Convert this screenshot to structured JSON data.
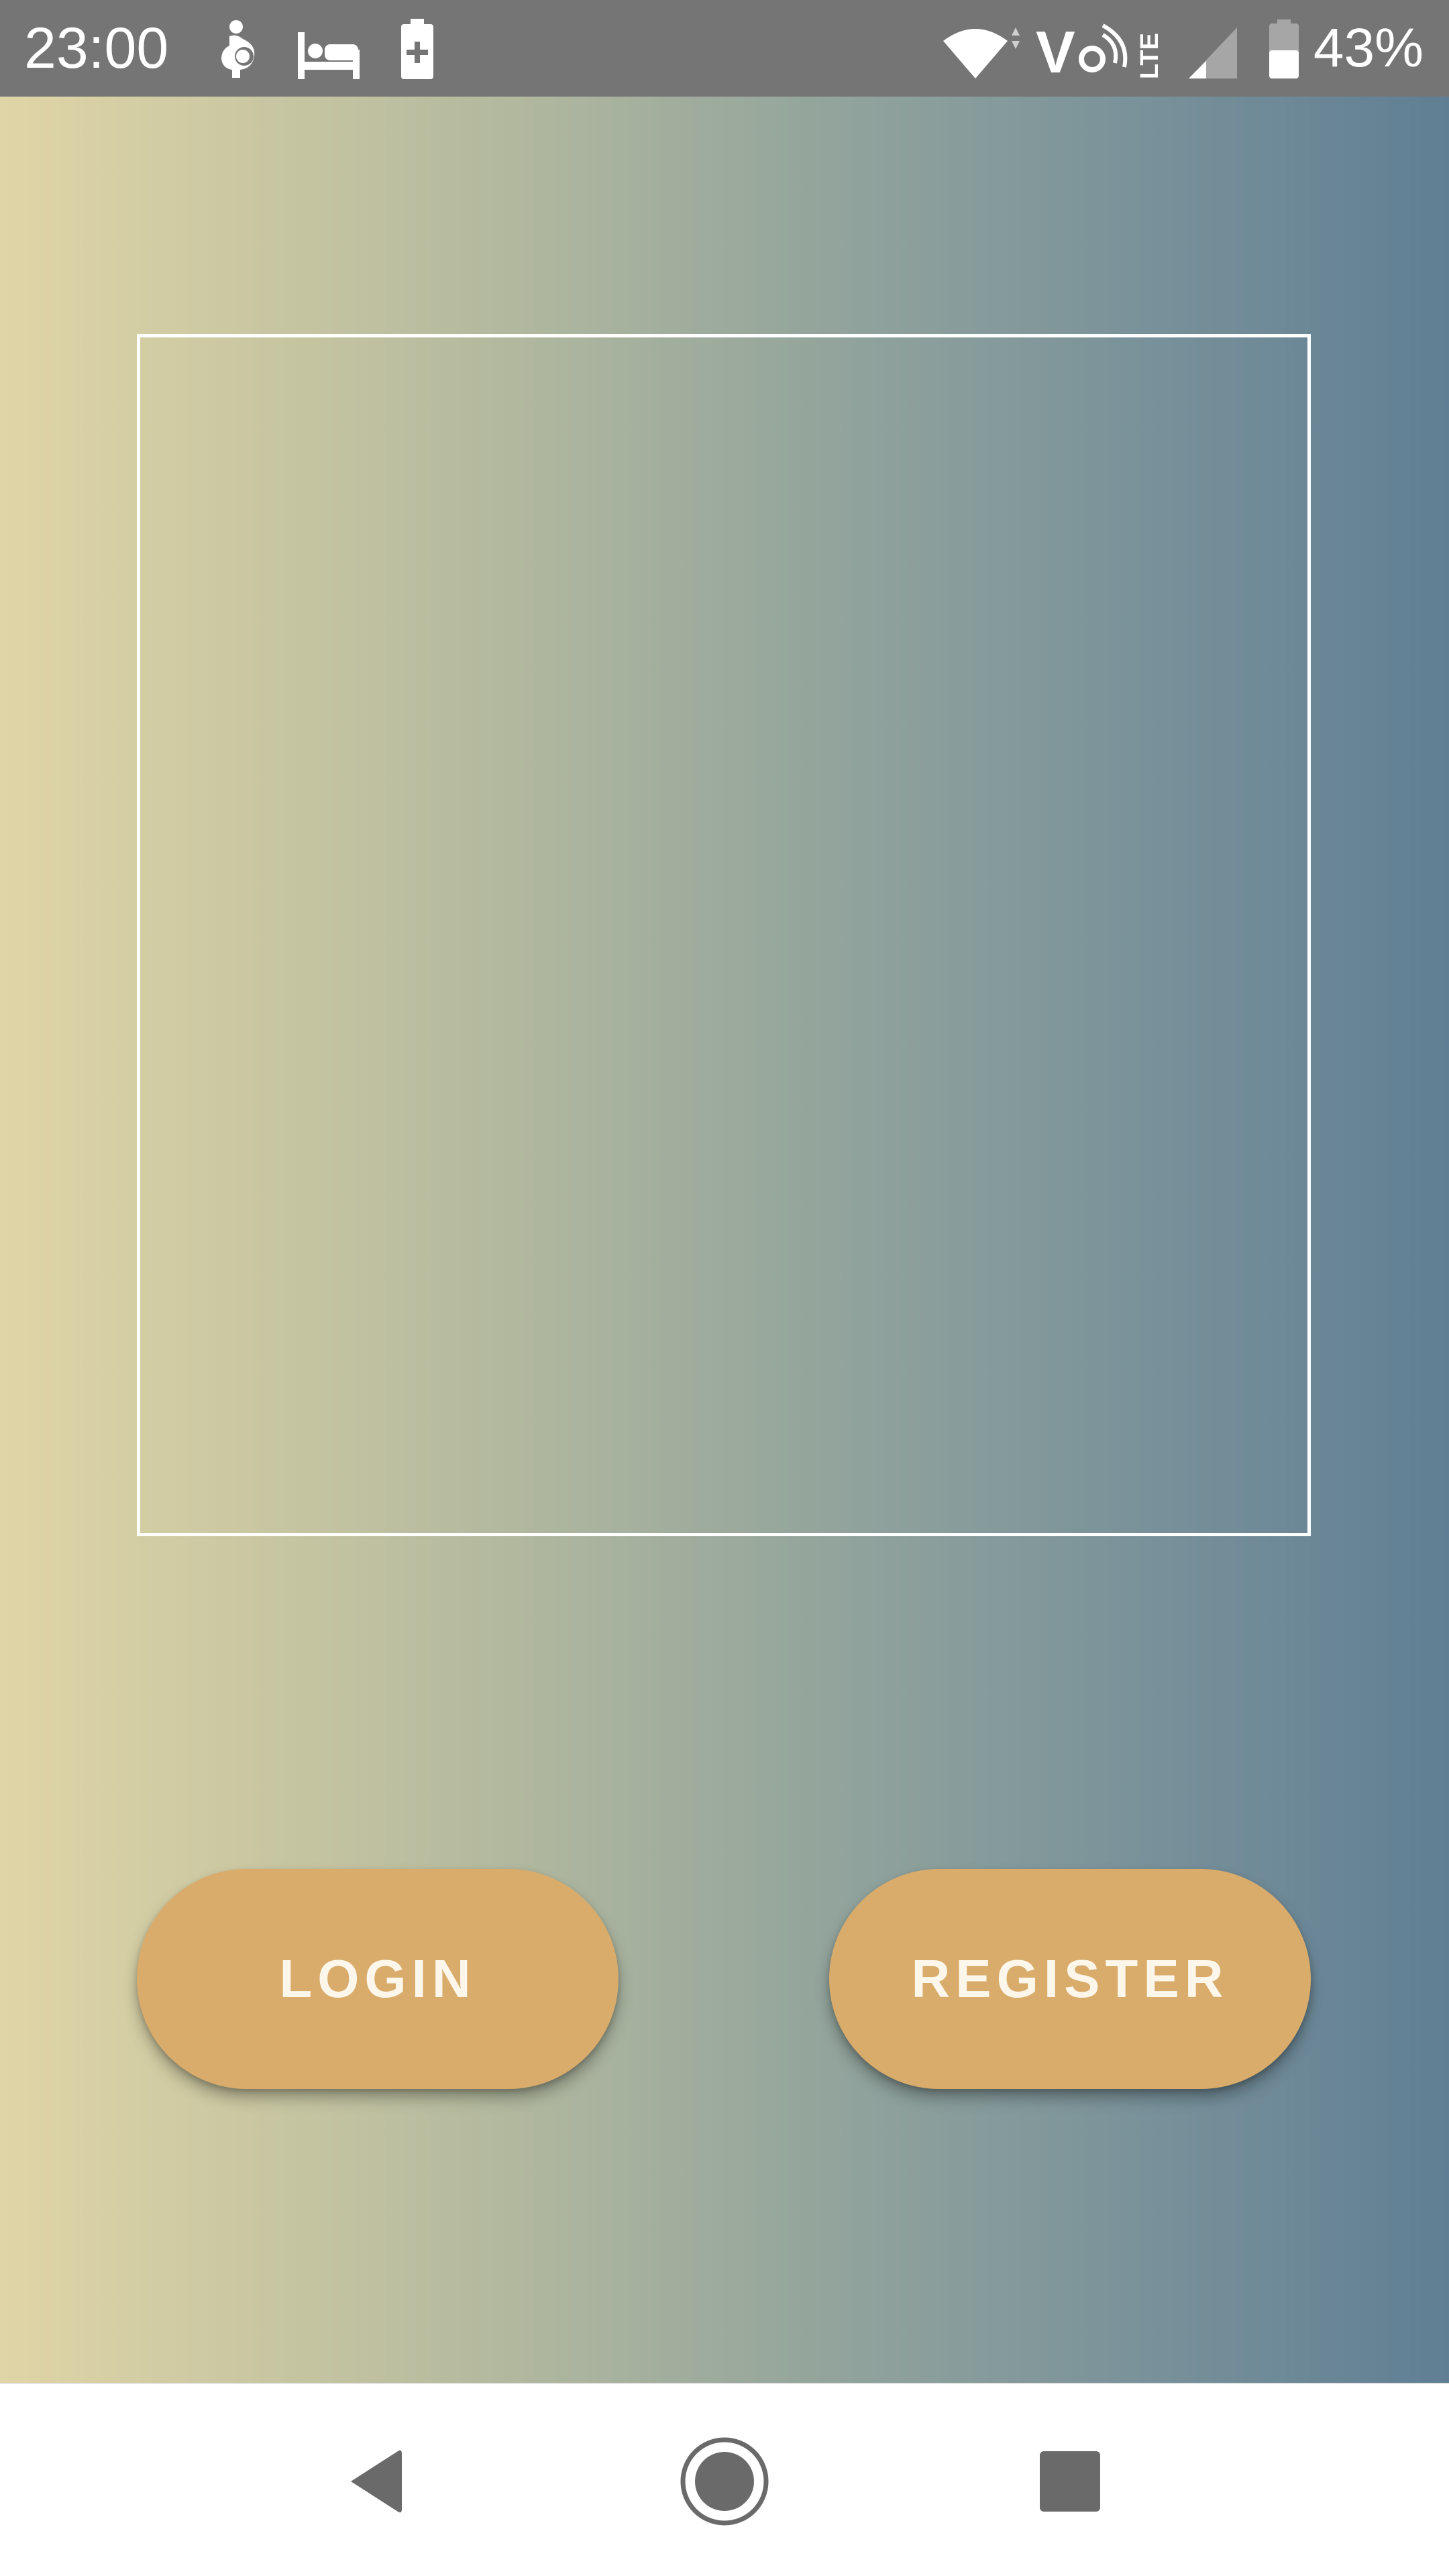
{
  "status_bar": {
    "time": "23:00",
    "battery_percent": "43%",
    "background_color": "#757575",
    "icons": [
      "pregnant-person-icon",
      "bed-icon",
      "battery-saver-icon",
      "wifi-icon",
      "volte-icon",
      "lte-icon",
      "cell-signal-icon",
      "battery-icon"
    ]
  },
  "main": {
    "gradient_colors": [
      "#e0d5a6",
      "#607f94"
    ],
    "frame_border_color": "#ffffff",
    "buttons": {
      "login_label": "LOGIN",
      "register_label": "REGISTER",
      "button_color": "#d9ac6b"
    }
  },
  "nav_bar": {
    "icons": [
      "back-icon",
      "home-icon",
      "recents-icon"
    ],
    "icon_color": "#6a6a6a"
  }
}
